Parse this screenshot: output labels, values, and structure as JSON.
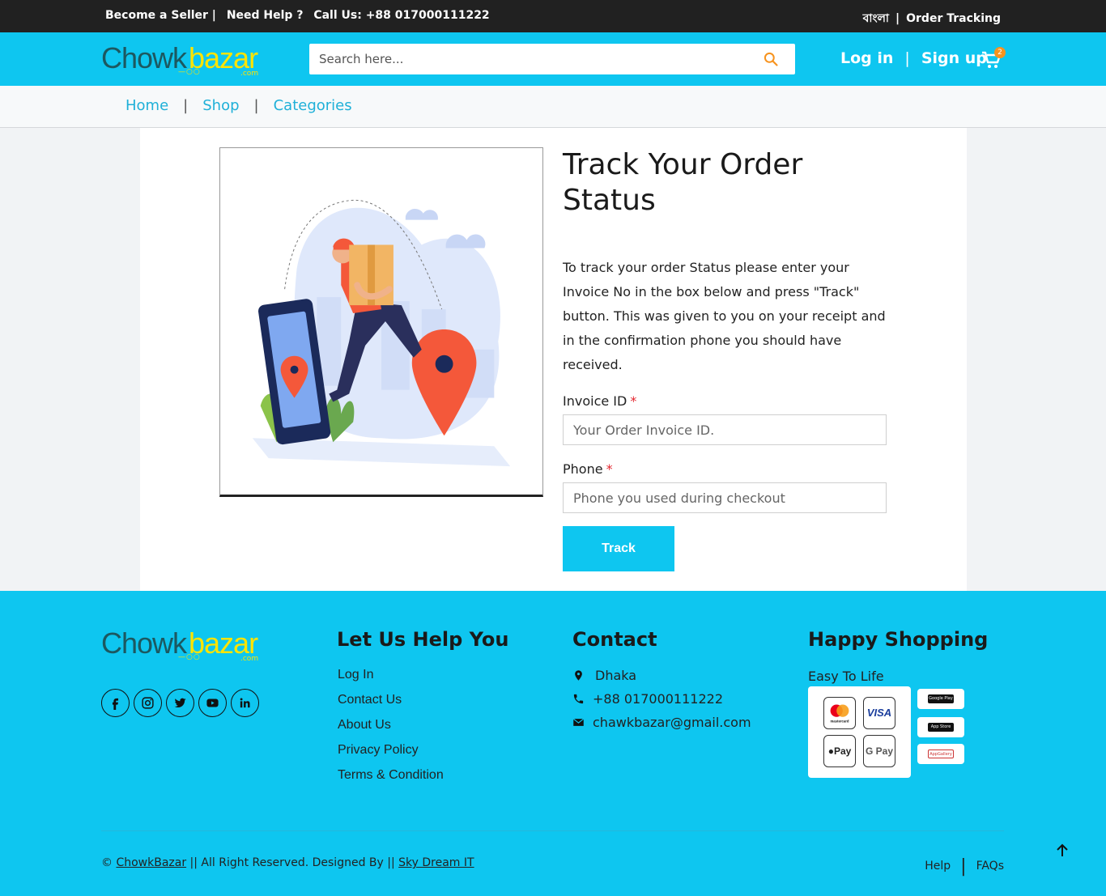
{
  "topbar": {
    "become_seller": "Become a Seller |",
    "need_help": "Need Help ?",
    "call_us": "Call Us: +88 017000111222",
    "language": "বাংলা",
    "separator": "|",
    "order_tracking": "Order Tracking"
  },
  "brand": {
    "part1": "Chowk",
    "part2": "bazar",
    "domain": ".com"
  },
  "search": {
    "placeholder": "Search here...",
    "value": ""
  },
  "header": {
    "login": "Log in",
    "separator": "|",
    "signup": "Sign up",
    "cart_count": "2"
  },
  "breadcrumb": {
    "home": "Home",
    "shop": "Shop",
    "categories": "Categories",
    "separator": "|"
  },
  "track": {
    "title": "Track Your Order Status",
    "description": "To track your order Status please enter your Invoice No in the box below and press \"Track\" button. This was given to you on your receipt and in the confirmation phone you should have received.",
    "invoice_label": "Invoice ID",
    "invoice_placeholder": "Your Order Invoice ID.",
    "phone_label": "Phone",
    "phone_placeholder": "Phone you used during checkout",
    "required_mark": "*",
    "button": "Track"
  },
  "footer": {
    "help_heading": "Let Us Help You",
    "help_links": [
      "Log In",
      "Contact Us",
      "About Us",
      "Privacy Policy",
      "Terms & Condition"
    ],
    "contact_heading": "Contact",
    "contact": {
      "city": "Dhaka",
      "phone": "+88 017000111222",
      "email": "chawkbazar@gmail.com"
    },
    "shopping_heading": "Happy Shopping",
    "tagline": "Easy To Life",
    "payments": [
      "mastercard",
      "VISA",
      "Pay",
      "G Pay"
    ],
    "stores": [
      "Google Play",
      "App Store",
      "AppGallery"
    ],
    "socials": [
      "facebook-icon",
      "instagram-icon",
      "twitter-icon",
      "youtube-icon",
      "linkedin-icon"
    ],
    "copyright_prefix": "©",
    "copyright_brand": "ChowkBazar",
    "copyright_middle": "|| All Right Reserved. Designed By ||",
    "copyright_designer": "Sky Dream IT",
    "bottom_links": [
      "Help",
      "FAQs"
    ],
    "bottom_separator": "|"
  },
  "colors": {
    "accent": "#0ec6f0",
    "topbar": "#212121",
    "brand_yellow": "#ffe400",
    "brand_teal": "#1c5860",
    "required": "#e4262e",
    "badge": "#f7931e"
  }
}
